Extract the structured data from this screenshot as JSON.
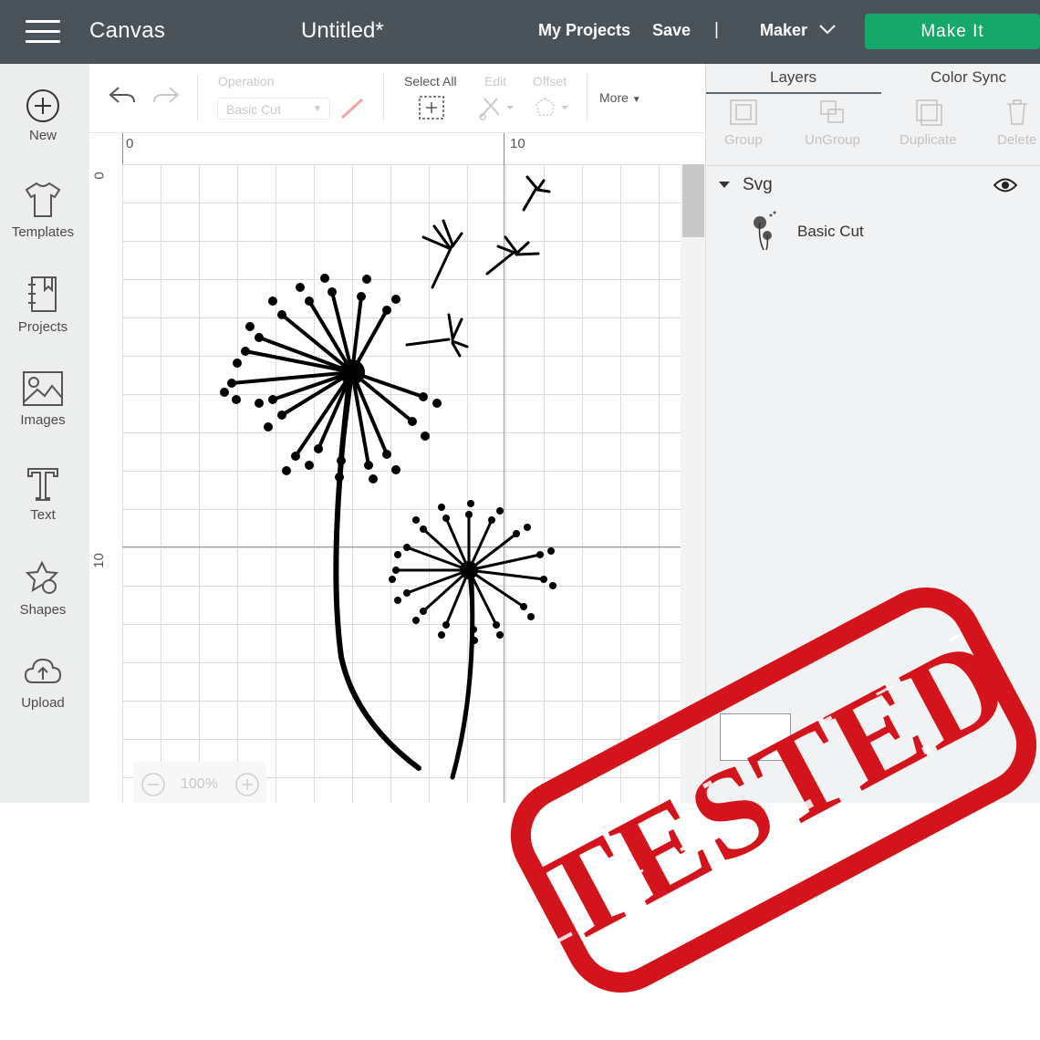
{
  "topbar": {
    "app_title": "Canvas",
    "doc_title": "Untitled*",
    "my_projects": "My Projects",
    "save": "Save",
    "separator": "|",
    "machine": "Maker",
    "make_it": "Make It"
  },
  "sidebar": {
    "items": [
      {
        "label": "New",
        "icon": "plus-circle-icon"
      },
      {
        "label": "Templates",
        "icon": "tshirt-icon"
      },
      {
        "label": "Projects",
        "icon": "notebook-icon"
      },
      {
        "label": "Images",
        "icon": "image-icon"
      },
      {
        "label": "Text",
        "icon": "text-t-icon"
      },
      {
        "label": "Shapes",
        "icon": "shapes-icon"
      },
      {
        "label": "Upload",
        "icon": "cloud-upload-icon"
      }
    ]
  },
  "toolbar": {
    "operation_label": "Operation",
    "operation_value": "Basic Cut",
    "select_all": "Select All",
    "edit": "Edit",
    "offset": "Offset",
    "more": "More"
  },
  "rulers": {
    "top": [
      "0",
      "10"
    ],
    "left": [
      "0",
      "10"
    ]
  },
  "zoom": {
    "level": "100%"
  },
  "panel": {
    "tabs": [
      "Layers",
      "Color Sync"
    ],
    "tools": [
      "Group",
      "UnGroup",
      "Duplicate",
      "Delete"
    ],
    "group_name": "Svg",
    "layer_name": "Basic Cut"
  },
  "stamp": {
    "text": "TESTED",
    "color": "#d4141c"
  },
  "colors": {
    "topbar": "#4a525a",
    "make_it": "#16a86b",
    "sidebar": "#eceded"
  }
}
